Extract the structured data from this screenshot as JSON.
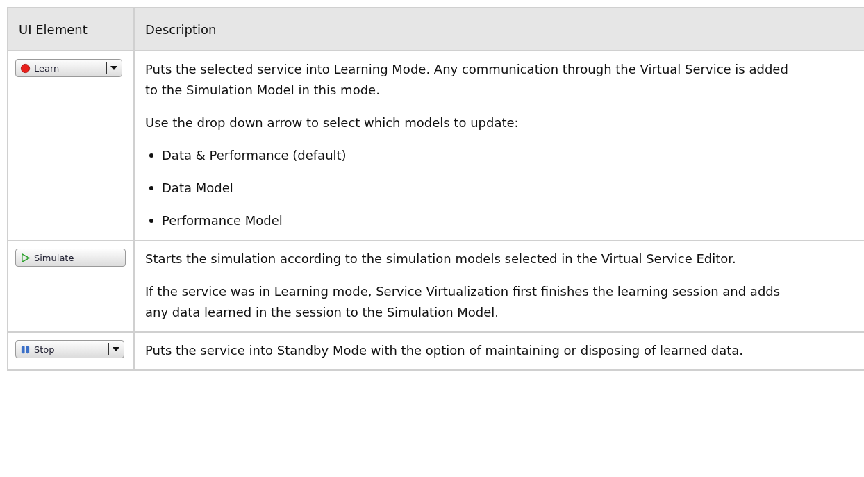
{
  "table": {
    "columns": [
      "UI Element",
      "Description"
    ],
    "rows": [
      {
        "button": {
          "kind": "learn",
          "label": "Learn",
          "dropdown": true
        },
        "blocks": [
          {
            "kind": "para",
            "text": "Puts the selected service into Learning Mode. Any communication through the Virtual Service is added to the Simulation Model in this mode."
          },
          {
            "kind": "para",
            "text": "Use the drop down arrow to select which models to update:"
          },
          {
            "kind": "list",
            "items": [
              "Data & Performance (default)",
              "Data Model",
              "Performance Model"
            ]
          }
        ]
      },
      {
        "button": {
          "kind": "simulate",
          "label": "Simulate",
          "dropdown": false
        },
        "blocks": [
          {
            "kind": "para",
            "text": "Starts the simulation according to the simulation models selected in the Virtual Service Editor."
          },
          {
            "kind": "para",
            "text": "If the service was in Learning mode, Service Virtualization first finishes the learning session and adds any data learned in the session to the Simulation Model."
          }
        ]
      },
      {
        "button": {
          "kind": "stop",
          "label": "Stop",
          "dropdown": true
        },
        "blocks": [
          {
            "kind": "para",
            "text": "Puts the service into Standby Mode with the option of maintaining or disposing of learned data."
          }
        ]
      }
    ]
  }
}
